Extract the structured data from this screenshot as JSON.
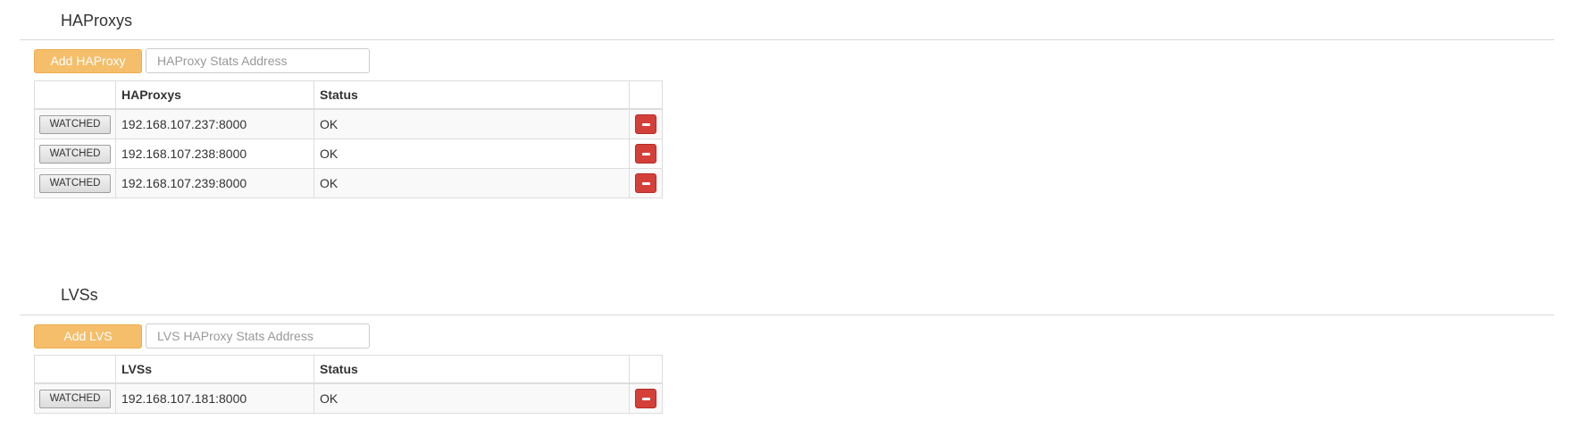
{
  "haproxys": {
    "title": "HAProxys",
    "add_label": "Add HAProxy",
    "input_placeholder": "HAProxy Stats Address",
    "input_value": "",
    "columns": [
      "",
      "HAProxys",
      "Status",
      ""
    ],
    "rows": [
      {
        "watch_label": "WATCHED",
        "address": "192.168.107.237:8000",
        "status": "OK"
      },
      {
        "watch_label": "WATCHED",
        "address": "192.168.107.238:8000",
        "status": "OK"
      },
      {
        "watch_label": "WATCHED",
        "address": "192.168.107.239:8000",
        "status": "OK"
      }
    ]
  },
  "lvss": {
    "title": "LVSs",
    "add_label": "Add LVS",
    "input_placeholder": "LVS HAProxy Stats Address",
    "input_value": "",
    "columns": [
      "",
      "LVSs",
      "Status",
      ""
    ],
    "rows": [
      {
        "watch_label": "WATCHED",
        "address": "192.168.107.181:8000",
        "status": "OK"
      }
    ]
  },
  "colors": {
    "add_button": "#f5be6b",
    "remove_button": "#d43f3a",
    "rule": "#d9d9d9"
  },
  "icons": {
    "remove": "minus-icon"
  }
}
